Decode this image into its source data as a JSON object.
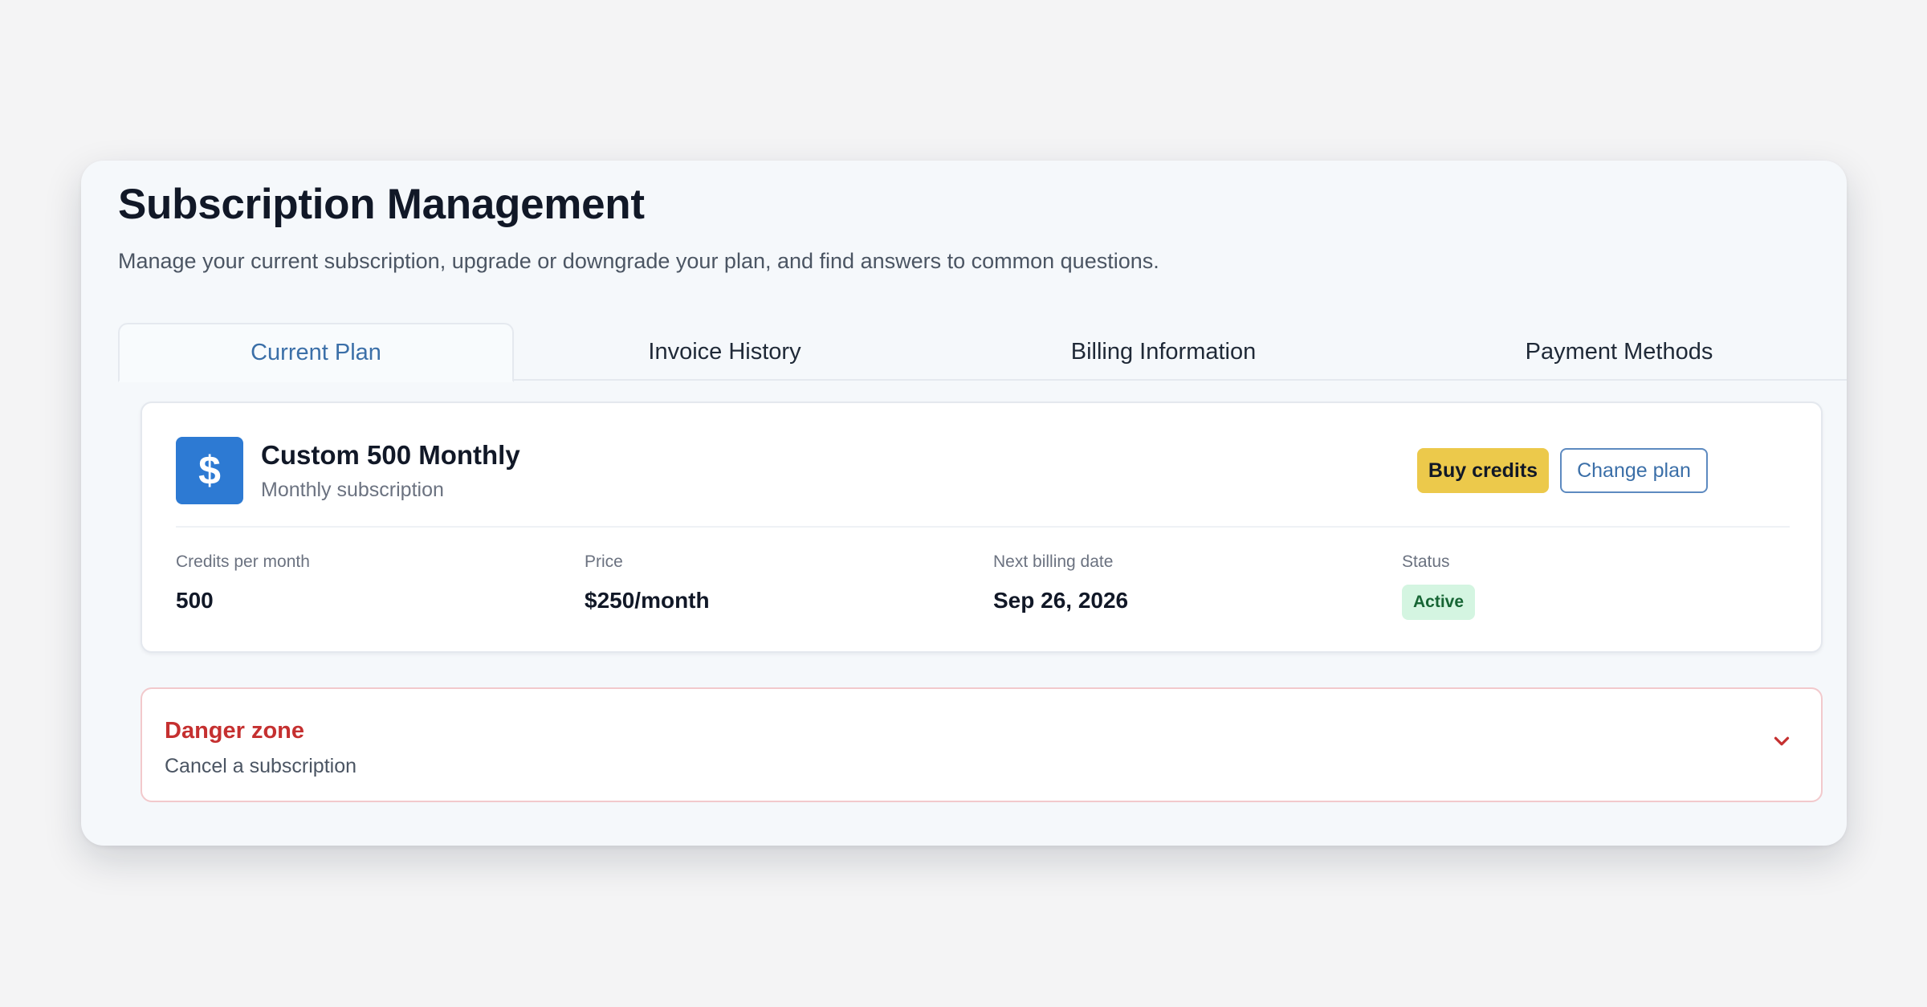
{
  "header": {
    "title": "Subscription Management",
    "subtitle": "Manage your current subscription, upgrade or downgrade your plan, and find answers to common questions."
  },
  "tabs": [
    {
      "label": "Current Plan",
      "active": true
    },
    {
      "label": "Invoice History",
      "active": false
    },
    {
      "label": "Billing Information",
      "active": false
    },
    {
      "label": "Payment Methods",
      "active": false
    }
  ],
  "plan": {
    "icon": "dollar-icon",
    "icon_glyph": "$",
    "name": "Custom 500 Monthly",
    "type": "Monthly subscription",
    "buy_credits_label": "Buy credits",
    "change_plan_label": "Change plan",
    "stats": [
      {
        "label": "Credits per month",
        "value": "500"
      },
      {
        "label": "Price",
        "value": "$250/month"
      },
      {
        "label": "Next billing date",
        "value": "Sep 26, 2026"
      },
      {
        "label": "Status",
        "value": "Active"
      }
    ]
  },
  "danger_zone": {
    "title": "Danger zone",
    "subtitle": "Cancel a subscription",
    "icon": "chevron-down-icon"
  },
  "colors": {
    "accent": "#3b6fa8",
    "plan_icon_bg": "#2d7ad3",
    "buy_button": "#ecc94b",
    "status_active_bg": "#d4f5e1",
    "danger": "#c53030"
  }
}
